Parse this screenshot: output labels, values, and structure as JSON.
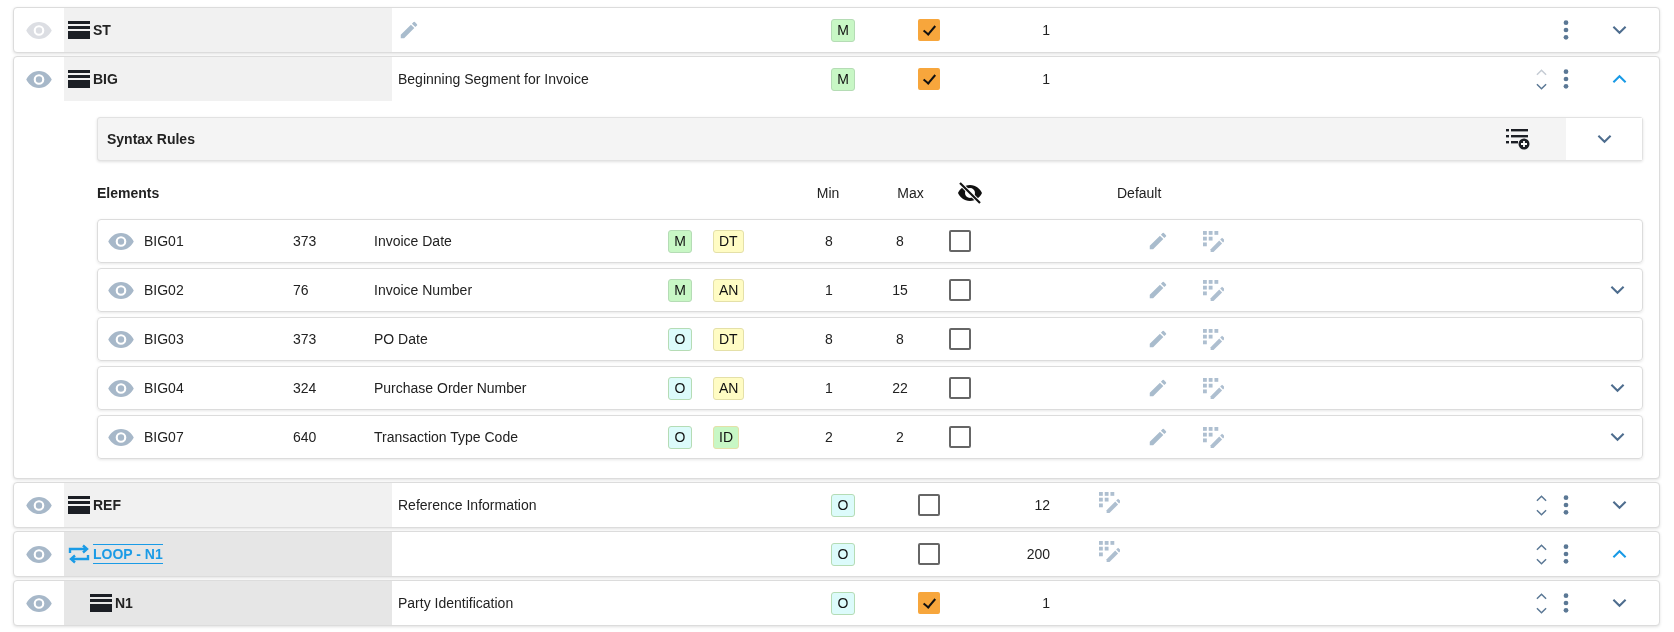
{
  "segments": [
    {
      "kind": "segment",
      "eye_disabled": true,
      "name": "ST",
      "description_editable": true,
      "required": {
        "text": "M",
        "color": "#c8f7c5"
      },
      "must_use": true,
      "repeat": "1",
      "reorder": false,
      "expanded": false
    },
    {
      "kind": "segment",
      "eye_disabled": false,
      "name": "BIG",
      "description": "Beginning Segment for Invoice",
      "required": {
        "text": "M",
        "color": "#c8f7c5"
      },
      "must_use": true,
      "repeat": "1",
      "reorder": true,
      "up_disabled": true,
      "expanded": true,
      "syntax_rules": {
        "title": "Syntax Rules",
        "expanded": false
      },
      "element_header": {
        "title": "Elements",
        "min": "Min",
        "max": "Max",
        "default": "Default"
      },
      "elements": [
        {
          "id": "BIG01",
          "ref": "373",
          "name": "Invoice Date",
          "required": {
            "text": "M",
            "color": "#c8f7c5"
          },
          "type": {
            "text": "DT",
            "color": "#fffcc4"
          },
          "min": "8",
          "max": "8",
          "checked": false,
          "expandable": false
        },
        {
          "id": "BIG02",
          "ref": "76",
          "name": "Invoice Number",
          "required": {
            "text": "M",
            "color": "#c8f7c5"
          },
          "type": {
            "text": "AN",
            "color": "#fffcc4"
          },
          "min": "1",
          "max": "15",
          "checked": false,
          "expandable": true
        },
        {
          "id": "BIG03",
          "ref": "373",
          "name": "PO Date",
          "required": {
            "text": "O",
            "color": "#dcfbfb"
          },
          "type": {
            "text": "DT",
            "color": "#fffcc4"
          },
          "min": "8",
          "max": "8",
          "checked": false,
          "expandable": false
        },
        {
          "id": "BIG04",
          "ref": "324",
          "name": "Purchase Order Number",
          "required": {
            "text": "O",
            "color": "#dcfbfb"
          },
          "type": {
            "text": "AN",
            "color": "#fffcc4"
          },
          "min": "1",
          "max": "22",
          "checked": false,
          "expandable": true
        },
        {
          "id": "BIG07",
          "ref": "640",
          "name": "Transaction Type Code",
          "required": {
            "text": "O",
            "color": "#dcfbfb"
          },
          "type": {
            "text": "ID",
            "color": "#c8f7c5"
          },
          "min": "2",
          "max": "2",
          "checked": false,
          "expandable": true
        }
      ]
    },
    {
      "kind": "segment",
      "eye_disabled": false,
      "name": "REF",
      "description": "Reference Information",
      "required": {
        "text": "O",
        "color": "#dcfbfb"
      },
      "must_use": false,
      "repeat": "12",
      "grid_icon": true,
      "reorder": true,
      "up_disabled": false,
      "expanded": false
    },
    {
      "kind": "loop",
      "eye_disabled": false,
      "name": "LOOP - N1",
      "required": {
        "text": "O",
        "color": "#dcfbfb"
      },
      "must_use": false,
      "repeat": "200",
      "grid_icon": true,
      "reorder": true,
      "up_disabled": false,
      "expanded": true,
      "children": [
        {
          "kind": "segment",
          "eye_disabled": false,
          "name": "N1",
          "description": "Party Identification",
          "required": {
            "text": "O",
            "color": "#dcfbfb"
          },
          "must_use": true,
          "repeat": "1",
          "reorder": true,
          "up_disabled": false,
          "expanded": false
        }
      ]
    }
  ]
}
